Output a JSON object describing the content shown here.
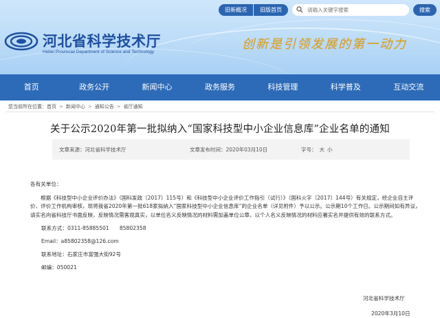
{
  "header": {
    "top_buttons": [
      "旧新概况",
      "旧版首页"
    ],
    "search_placeholder": "请输入关键字搜索",
    "search_button": "搜索",
    "site_title": "河北省科学技术厅",
    "site_subtitle": "Hebei Provincial Department of Science and Technology",
    "slogan": "创新是引领发展的第一动力",
    "colors": {
      "nav_bg": "#2d6bb8",
      "title_blue": "#1f4fa0",
      "slogan_gold": "#e0a01c"
    }
  },
  "nav": {
    "items": [
      "首页",
      "政务公开",
      "新闻中心",
      "政务服务",
      "科技管理",
      "科学普及",
      "互动交流"
    ]
  },
  "breadcrumb": {
    "prefix": "您当前所在位置：",
    "items": [
      "首页",
      "新闻中心",
      "通知公告",
      "省厅通知"
    ]
  },
  "article": {
    "title": "关于公示2020年第一批拟纳入“国家科技型中小企业信息库”企业名单的通知",
    "source": "文章来源：河北省科学技术厅",
    "date": "文章发布时间：2020年03月10日",
    "font_size_label": "字号：",
    "font_large": "大",
    "font_small": "小",
    "salutation": "各有关单位：",
    "paragraph": "根据《科技型中小企业评价办法》（国科发政〔2017〕115号）和《科技型中小企业评价工作指引（试行）》（国科火字〔2017〕144号）有关规定，经企业自主评价、评价工作机构审核，现将我省2020年第一批618家拟纳入“国家科技型中小企业信息库”的企业名单（详见附件）予以公示。公示期10个工作日。公示期间如有异议，请实名向省科技厅书面反映，反映情况需客观真实，以单位名义反映情况的材料需加盖单位公章，以个人名义反映情况的材料应署实名并提供有效的联系方式。",
    "contacts": [
      "联系方式：0311-85885501　　85802358",
      "Email：a85802358@126.com",
      "联系地址：石家庄市富强大街92号",
      "邮编：050021"
    ],
    "signature_org": "河北省科学技术厅",
    "signature_date": "2020年3月10日"
  }
}
